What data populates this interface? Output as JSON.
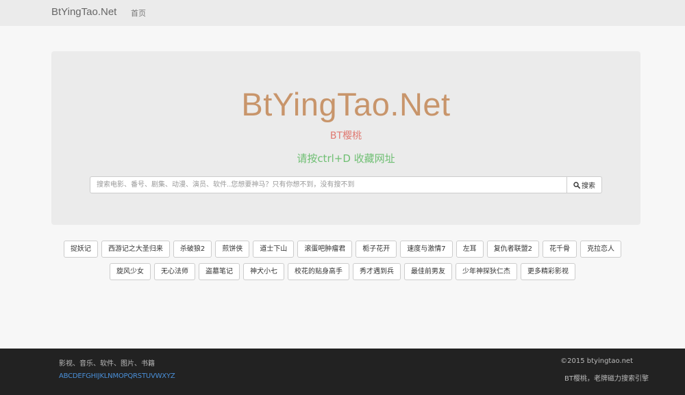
{
  "navbar": {
    "brand": "BtYingTao.Net",
    "home": "首页"
  },
  "hero": {
    "title": "BtYingTao.Net",
    "subtitle": "BT樱桃",
    "tip": "请按ctrl+D 收藏网址"
  },
  "search": {
    "placeholder": "搜索电影、番号、剧集、动漫、演员、软件..您想要神马？只有你想不到，没有搜不到",
    "button_label": "搜索",
    "button_icon": "search-icon"
  },
  "tags": {
    "row1": [
      "捉妖记",
      "西游记之大圣归来",
      "杀破狼2",
      "煎饼侠",
      "道士下山",
      "滚蛋吧肿瘤君",
      "栀子花开",
      "速度与激情7",
      "左耳",
      "复仇者联盟2",
      "花千骨",
      "克拉恋人"
    ],
    "row2": [
      "旋风少女",
      "无心法师",
      "盗墓笔记",
      "神犬小七",
      "校花的贴身高手",
      "秀才遇到兵",
      "最佳前男友",
      "少年神探狄仁杰",
      "更多精彩影视"
    ]
  },
  "footer": {
    "categories": "影视、音乐、软件、图片、书籍",
    "letters": "ABCDEFGHIJKLNMOPQRSTUVWXYZ",
    "copyright": "©2015 btyingtao.net",
    "slogan": "BT樱桃，老牌磁力搜索引擎"
  },
  "colors": {
    "hero_title": "#c8956b",
    "hero_subtitle": "#e07a72",
    "hero_tip": "#6fbf73",
    "footer_bg": "#222222",
    "link_blue": "#4a90d9"
  }
}
